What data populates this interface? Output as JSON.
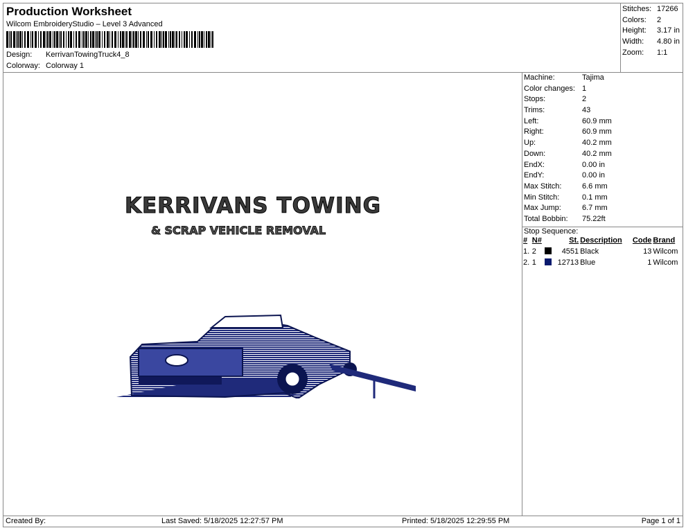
{
  "header": {
    "title": "Production Worksheet",
    "software": "Wilcom EmbroideryStudio – Level 3 Advanced",
    "design_label": "Design:",
    "design_value": "KerrivanTowingTruck4_8",
    "colorway_label": "Colorway:",
    "colorway_value": "Colorway 1"
  },
  "stats": [
    {
      "label": "Stitches:",
      "value": "17266"
    },
    {
      "label": "Colors:",
      "value": "2"
    },
    {
      "label": "Height:",
      "value": "3.17 in"
    },
    {
      "label": "Width:",
      "value": "4.80 in"
    },
    {
      "label": "Zoom:",
      "value": "1:1"
    }
  ],
  "machine_info": [
    {
      "label": "Machine:",
      "value": "Tajima"
    },
    {
      "label": "Color changes:",
      "value": "1"
    },
    {
      "label": "Stops:",
      "value": "2"
    },
    {
      "label": "Trims:",
      "value": "43"
    },
    {
      "label": "Left:",
      "value": "60.9 mm"
    },
    {
      "label": "Right:",
      "value": "60.9 mm"
    },
    {
      "label": "Up:",
      "value": "40.2 mm"
    },
    {
      "label": "Down:",
      "value": "40.2 mm"
    },
    {
      "label": "EndX:",
      "value": "0.00 in"
    },
    {
      "label": "EndY:",
      "value": "0.00 in"
    },
    {
      "label": "Max Stitch:",
      "value": "6.6 mm"
    },
    {
      "label": "Min Stitch:",
      "value": "0.1 mm"
    },
    {
      "label": "Max Jump:",
      "value": "6.7 mm"
    },
    {
      "label": "Total Bobbin:",
      "value": "75.22ft"
    }
  ],
  "stop_sequence": {
    "title": "Stop Sequence:",
    "columns": [
      "#",
      "N#",
      "St.",
      "Description",
      "Code",
      "Brand"
    ],
    "rows": [
      {
        "idx": "1.",
        "n": "2",
        "color": "#000000",
        "st": "4551",
        "desc": "Black",
        "code": "13",
        "brand": "Wilcom"
      },
      {
        "idx": "2.",
        "n": "1",
        "color": "#0a1a6e",
        "st": "12713",
        "desc": "Blue",
        "code": "1",
        "brand": "Wilcom"
      }
    ]
  },
  "design": {
    "line1": "KERRIVANS TOWING",
    "line2": "& SCRAP VEHICLE REMOVAL",
    "thread_color": "#1f2a7a"
  },
  "footer": {
    "created_by": "Created By:",
    "last_saved": "Last Saved: 5/18/2025 12:27:57 PM",
    "printed": "Printed: 5/18/2025 12:29:55 PM",
    "page": "Page 1 of 1"
  }
}
